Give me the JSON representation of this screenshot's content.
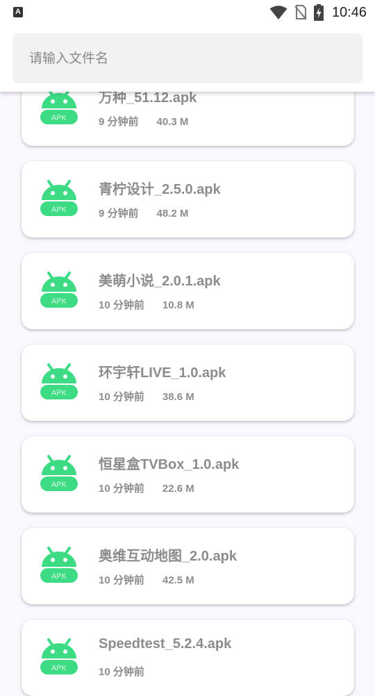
{
  "status_bar": {
    "notification_icon": "A",
    "time": "10:46",
    "icons": [
      "wifi-icon",
      "sim-off-icon",
      "battery-charging-icon"
    ]
  },
  "search": {
    "placeholder": "请输入文件名",
    "value": ""
  },
  "apk_icon_label": "APK",
  "colors": {
    "accent_green": "#3ddc84",
    "icon_label": "#d8f7e6",
    "text_gray": "#8c8c8c",
    "search_bg": "#f2f2f2"
  },
  "files": [
    {
      "name": "万种_51.12.apk",
      "time": "9 分钟前",
      "size": "40.3 M"
    },
    {
      "name": "青柠设计_2.5.0.apk",
      "time": "9 分钟前",
      "size": "48.2 M"
    },
    {
      "name": "美萌小说_2.0.1.apk",
      "time": "10 分钟前",
      "size": "10.8 M"
    },
    {
      "name": "环宇轩LIVE_1.0.apk",
      "time": "10 分钟前",
      "size": "38.6 M"
    },
    {
      "name": "恒星盒TVBox_1.0.apk",
      "time": "10 分钟前",
      "size": "22.6 M"
    },
    {
      "name": "奥维互动地图_2.0.apk",
      "time": "10 分钟前",
      "size": "42.5 M"
    },
    {
      "name": "Speedtest_5.2.4.apk",
      "time": "10 分钟前",
      "size": ""
    }
  ]
}
